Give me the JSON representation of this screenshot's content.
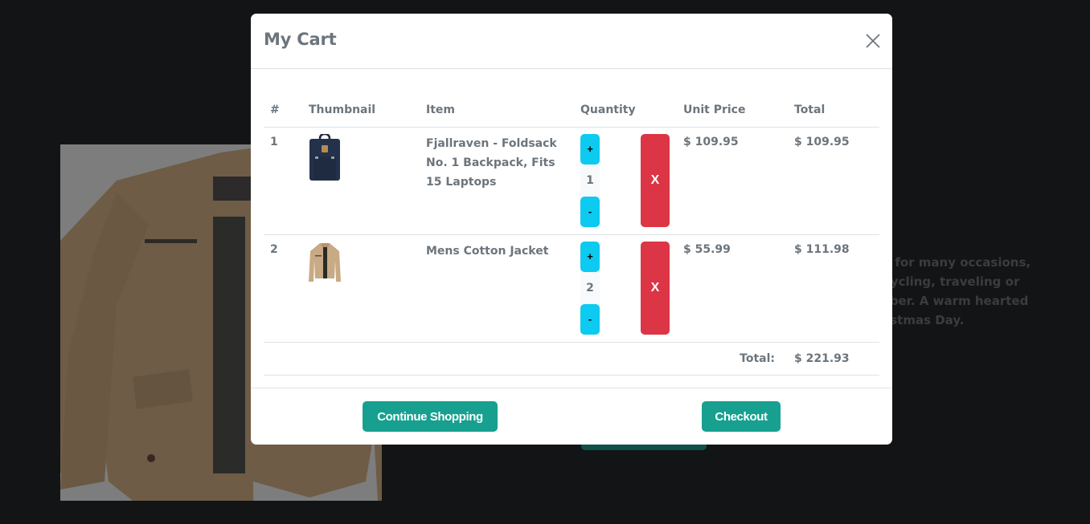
{
  "background": {
    "description_lines": [
      "suitable for many occasions,",
      "nbing, cycling, traveling or",
      "ily member. A warm hearted",
      "Christmas Day."
    ]
  },
  "modal": {
    "title": "My Cart",
    "close_icon": "close-icon",
    "table": {
      "headers": [
        "#",
        "Thumbnail",
        "Item",
        "Quantity",
        "Unit Price",
        "Total"
      ],
      "rows": [
        {
          "index": "1",
          "thumbnail": "backpack-thumbnail",
          "item": "Fjallraven - Foldsack No. 1 Backpack, Fits 15 Laptops",
          "increment_label": "+",
          "quantity": "1",
          "decrement_label": "-",
          "remove_label": "X",
          "unit_price": "$ 109.95",
          "total": "$ 109.95"
        },
        {
          "index": "2",
          "thumbnail": "jacket-thumbnail",
          "item": "Mens Cotton Jacket",
          "increment_label": "+",
          "quantity": "2",
          "decrement_label": "-",
          "remove_label": "X",
          "unit_price": "$ 55.99",
          "total": "$ 111.98"
        }
      ],
      "grand_total_label": "Total:",
      "grand_total": "$ 221.93"
    },
    "footer": {
      "continue_label": "Continue Shopping",
      "checkout_label": "Checkout"
    }
  },
  "colors": {
    "accent": "#17a08f",
    "info": "#0dcaf0",
    "danger": "#dc3545",
    "text_muted": "#6c757d",
    "page_bg": "#131416"
  }
}
